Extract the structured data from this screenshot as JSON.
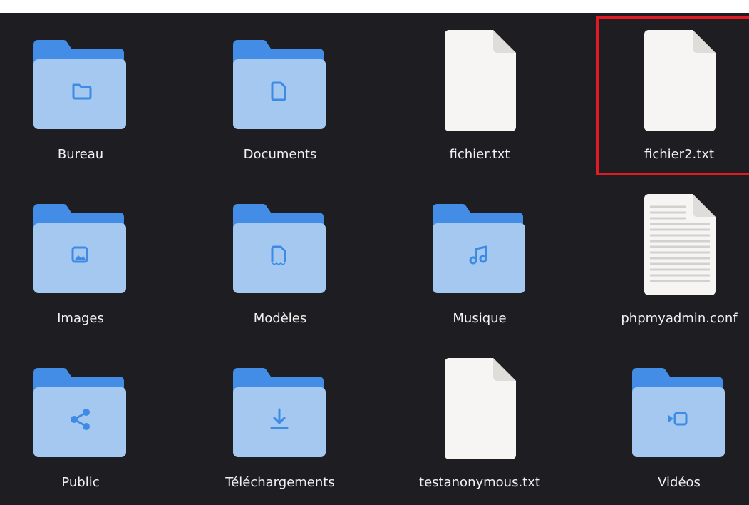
{
  "files": [
    {
      "label": "Bureau",
      "kind": "folder",
      "glyph": "folder-icon"
    },
    {
      "label": "Documents",
      "kind": "folder",
      "glyph": "document-icon"
    },
    {
      "label": "fichier.txt",
      "kind": "file",
      "glyph": "blank-file-icon"
    },
    {
      "label": "fichier2.txt",
      "kind": "file",
      "glyph": "blank-file-icon",
      "selected": true
    },
    {
      "label": "Images",
      "kind": "folder",
      "glyph": "picture-icon"
    },
    {
      "label": "Modèles",
      "kind": "folder",
      "glyph": "template-icon"
    },
    {
      "label": "Musique",
      "kind": "folder",
      "glyph": "music-note-icon"
    },
    {
      "label": "phpmyadmin.conf",
      "kind": "file",
      "glyph": "text-file-icon"
    },
    {
      "label": "Public",
      "kind": "folder",
      "glyph": "share-icon"
    },
    {
      "label": "Téléchargements",
      "kind": "folder",
      "glyph": "download-icon"
    },
    {
      "label": "testanonymous.txt",
      "kind": "file",
      "glyph": "blank-file-icon"
    },
    {
      "label": "Vidéos",
      "kind": "folder",
      "glyph": "video-camera-icon"
    }
  ],
  "colors": {
    "background": "#1e1e22",
    "folder_back": "#438de6",
    "folder_front": "#a4c8f0",
    "folder_glyph": "#3d8be5",
    "file_page": "#f6f5f4",
    "file_corner": "#deddda",
    "file_lines": "#d2d1ce",
    "selection": "#e01b24",
    "text": "#f2f2f2"
  }
}
